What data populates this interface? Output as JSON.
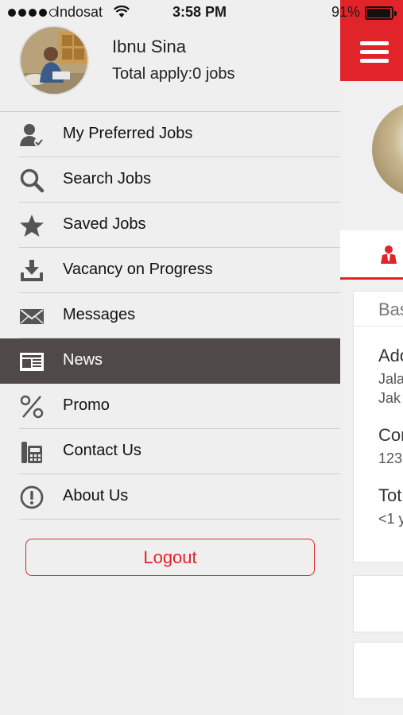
{
  "status_bar": {
    "carrier": "Indosat",
    "time": "3:58 PM",
    "battery_percent": "91%",
    "battery_level": 0.91,
    "signal_bars_filled": 4,
    "signal_bars_total": 5
  },
  "colors": {
    "brand_red": "#e1242a",
    "active_menu_bg": "#4f4a47",
    "drawer_bg": "#efefef"
  },
  "profile": {
    "name": "Ibnu Sina",
    "apply_status": "Total apply:0 jobs"
  },
  "menu": {
    "items": [
      {
        "label": "My Preferred Jobs",
        "icon": "user-check-icon",
        "active": false
      },
      {
        "label": "Search Jobs",
        "icon": "search-icon",
        "active": false
      },
      {
        "label": "Saved Jobs",
        "icon": "star-icon",
        "active": false
      },
      {
        "label": "Vacancy on Progress",
        "icon": "download-tray-icon",
        "active": false
      },
      {
        "label": "Messages",
        "icon": "envelope-icon",
        "active": false
      },
      {
        "label": "News",
        "icon": "newspaper-icon",
        "active": true
      },
      {
        "label": "Promo",
        "icon": "percent-icon",
        "active": false
      },
      {
        "label": "Contact Us",
        "icon": "fax-phone-icon",
        "active": false
      },
      {
        "label": "About Us",
        "icon": "info-exclamation-icon",
        "active": false
      }
    ]
  },
  "logout_label": "Logout",
  "main_view": {
    "menu_icon": "hamburger-icon",
    "tab_icon": "person-tie-icon",
    "card": {
      "header": "Bas",
      "address_title": "Ado",
      "address_line1": "Jala",
      "address_line2": "Jak",
      "contact_title": "Con",
      "contact_value": "123",
      "total_title": "Tot",
      "total_value": "<1 y"
    }
  }
}
